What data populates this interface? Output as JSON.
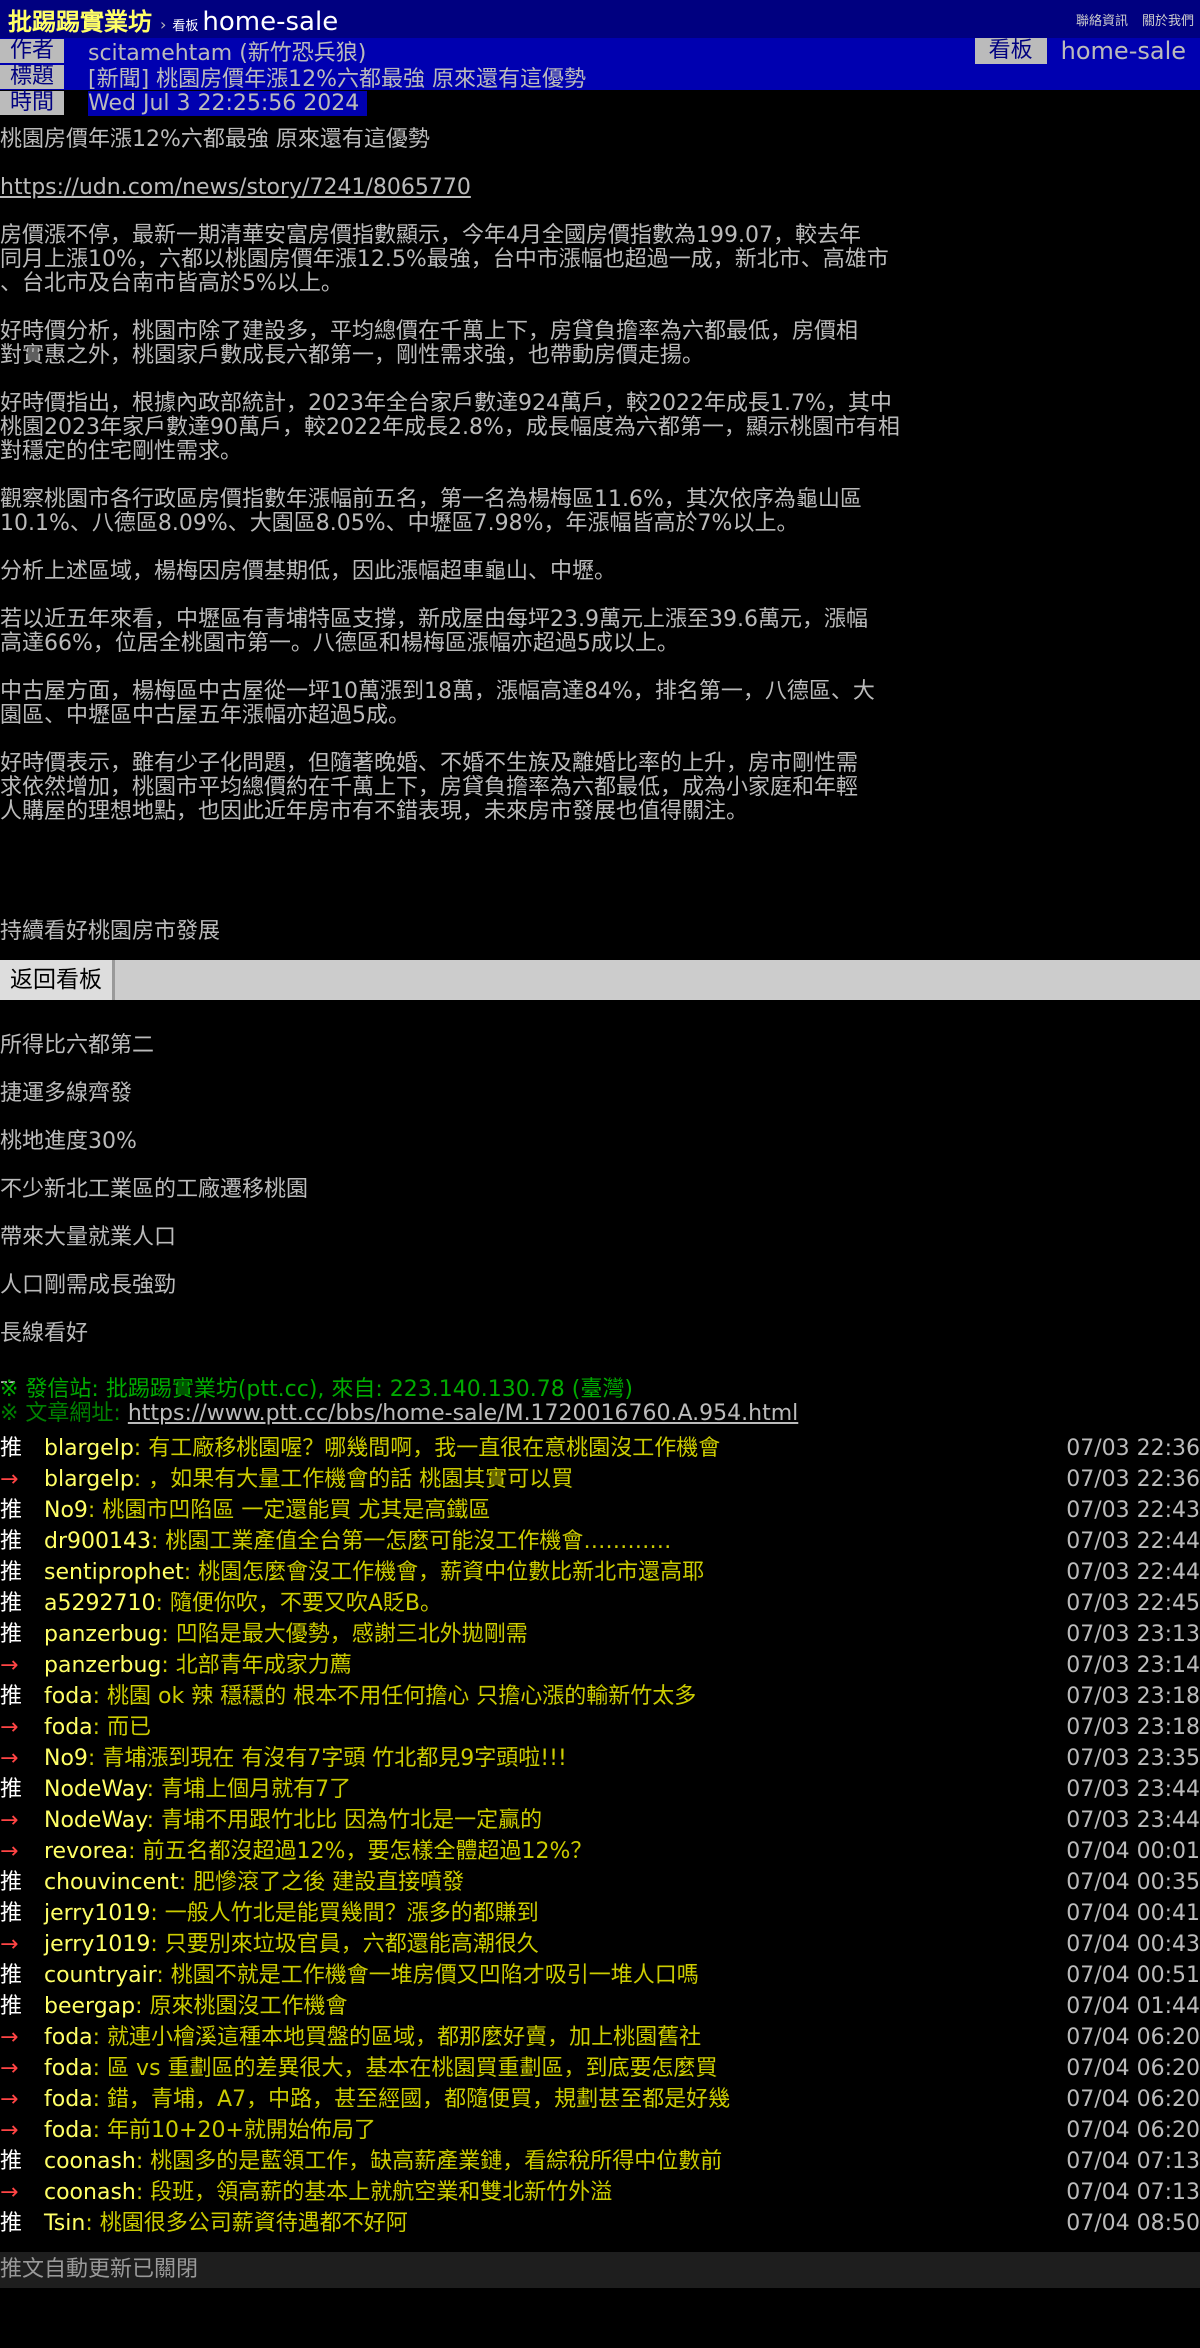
{
  "header": {
    "site": "批踢踢實業坊",
    "sep": "›",
    "board_tag": "看板",
    "board": "home-sale",
    "links": [
      "聯絡資訊",
      "關於我們"
    ]
  },
  "meta": {
    "author_tag": "作者",
    "author": "scitamehtam (新竹恐兵狼)",
    "title_tag": "標題",
    "title": "[新聞] 桃園房價年漲12%六都最強 原來還有這優勢",
    "time_tag": "時間",
    "time": "Wed Jul  3 22:25:56 2024",
    "board_tag": "看板",
    "board": "home-sale"
  },
  "article": {
    "headline": "桃園房價年漲12%六都最強 原來還有這優勢",
    "url": "https://udn.com/news/story/7241/8065770",
    "paragraphs": [
      "房價漲不停，最新一期清華安富房價指數顯示，今年4月全國房價指數為199.07，較去年\n同月上漲10%，六都以桃園房價年漲12.5%最強，台中市漲幅也超過一成，新北市、高雄市\n、台北市及台南市皆高於5%以上。",
      "好時價分析，桃園市除了建設多，平均總價在千萬上下，房貸負擔率為六都最低，房價相\n對實惠之外，桃園家戶數成長六都第一，剛性需求強，也帶動房價走揚。",
      "好時價指出，根據內政部統計，2023年全台家戶數達924萬戶，較2022年成長1.7%，其中\n桃園2023年家戶數達90萬戶，較2022年成長2.8%，成長幅度為六都第一，顯示桃園市有相\n對穩定的住宅剛性需求。",
      "觀察桃園市各行政區房價指數年漲幅前五名，第一名為楊梅區11.6%，其次依序為龜山區\n10.1%、八德區8.09%、大園區8.05%、中壢區7.98%，年漲幅皆高於7%以上。",
      "分析上述區域，楊梅因房價基期低，因此漲幅超車龜山、中壢。",
      "若以近五年來看，中壢區有青埔特區支撐，新成屋由每坪23.9萬元上漲至39.6萬元，漲幅\n高達66%，位居全桃園市第一。八德區和楊梅區漲幅亦超過5成以上。",
      "中古屋方面，楊梅區中古屋從一坪10萬漲到18萬，漲幅高達84%，排名第一，八德區、大\n園區、中壢區中古屋五年漲幅亦超過5成。",
      "好時價表示，雖有少子化問題，但隨著晚婚、不婚不生族及離婚比率的上升，房市剛性需\n求依然增加，桃園市平均總價約在千萬上下，房貸負擔率為六都最低，成為小家庭和年輕\n人購屋的理想地點，也因此近年房市有不錯表現，未來房市發展也值得關注。"
    ],
    "closing": "持續看好桃園房市發展"
  },
  "back_button": "返回看板",
  "signature_lines": [
    "所得比六都第二",
    "捷運多線齊發",
    "桃地進度30%",
    "不少新北工業區的工廠遷移桃園",
    "帶來大量就業人口",
    "人口剛需成長強勁",
    "長線看好"
  ],
  "footer": {
    "divider": "--",
    "source_prefix": "※ 發信站: ",
    "source_text": "批踢踢實業坊(ptt.cc), 來自: 223.140.130.78 (臺灣)",
    "url_prefix": "※ 文章網址: ",
    "url": "https://www.ptt.cc/bbs/home-sale/M.1720016760.A.954.html"
  },
  "pushes": [
    {
      "tag": "推",
      "user": "blargelp",
      "content": ": 有工廠移桃園喔？哪幾間啊，我一直很在意桃園沒工作機會",
      "time": "07/03 22:36"
    },
    {
      "tag": "→",
      "user": "blargelp",
      "content": ": ，如果有大量工作機會的話 桃園其實可以買",
      "time": "07/03 22:36"
    },
    {
      "tag": "推",
      "user": "No9",
      "content": ": 桃園市凹陷區 一定還能買 尤其是高鐵區",
      "time": "07/03 22:43"
    },
    {
      "tag": "推",
      "user": "dr900143",
      "content": ": 桃園工業產值全台第一怎麼可能沒工作機會…………",
      "time": "07/03 22:44"
    },
    {
      "tag": "推",
      "user": "sentiprophet",
      "content": ": 桃園怎麼會沒工作機會，薪資中位數比新北市還高耶",
      "time": "07/03 22:44"
    },
    {
      "tag": "推",
      "user": "a5292710",
      "content": ": 隨便你吹，不要又吹A貶B。",
      "time": "07/03 22:45"
    },
    {
      "tag": "推",
      "user": "panzerbug",
      "content": ": 凹陷是最大優勢，感謝三北外拋剛需",
      "time": "07/03 23:13"
    },
    {
      "tag": "→",
      "user": "panzerbug",
      "content": ": 北部青年成家力薦",
      "time": "07/03 23:14"
    },
    {
      "tag": "推",
      "user": "foda",
      "content": ": 桃園 ok 辣 穩穩的 根本不用任何擔心 只擔心漲的輸新竹太多",
      "time": "07/03 23:18"
    },
    {
      "tag": "→",
      "user": "foda",
      "content": ": 而已",
      "time": "07/03 23:18"
    },
    {
      "tag": "→",
      "user": "No9",
      "content": ": 青埔漲到現在 有沒有7字頭 竹北都見9字頭啦!!!",
      "time": "07/03 23:35"
    },
    {
      "tag": "推",
      "user": "NodeWay",
      "content": ": 青埔上個月就有7了",
      "time": "07/03 23:44"
    },
    {
      "tag": "→",
      "user": "NodeWay",
      "content": ": 青埔不用跟竹北比 因為竹北是一定贏的",
      "time": "07/03 23:44"
    },
    {
      "tag": "→",
      "user": "revorea",
      "content": ": 前五名都沒超過12%，要怎樣全體超過12%？",
      "time": "07/04 00:01"
    },
    {
      "tag": "推",
      "user": "chouvincent",
      "content": ": 肥慘滾了之後 建設直接噴發",
      "time": "07/04 00:35"
    },
    {
      "tag": "推",
      "user": "jerry1019",
      "content": ": 一般人竹北是能買幾間？漲多的都賺到",
      "time": "07/04 00:41"
    },
    {
      "tag": "→",
      "user": "jerry1019",
      "content": ": 只要別來垃圾官員，六都還能高潮很久",
      "time": "07/04 00:43"
    },
    {
      "tag": "推",
      "user": "countryair",
      "content": ": 桃園不就是工作機會一堆房價又凹陷才吸引一堆人口嗎",
      "time": "07/04 00:51"
    },
    {
      "tag": "推",
      "user": "beergap",
      "content": ": 原來桃園沒工作機會",
      "time": "07/04 01:44"
    },
    {
      "tag": "→",
      "user": "foda",
      "content": ": 就連小檜溪這種本地買盤的區域，都那麼好賣，加上桃園舊社",
      "time": "07/04 06:20"
    },
    {
      "tag": "→",
      "user": "foda",
      "content": ": 區 vs 重劃區的差異很大，基本在桃園買重劃區，到底要怎麼買",
      "time": "07/04 06:20"
    },
    {
      "tag": "→",
      "user": "foda",
      "content": ": 錯，青埔，A7，中路，甚至經國，都隨便買，規劃甚至都是好幾",
      "time": "07/04 06:20"
    },
    {
      "tag": "→",
      "user": "foda",
      "content": ": 年前10+20+就開始佈局了",
      "time": "07/04 06:20"
    },
    {
      "tag": "推",
      "user": "coonash",
      "content": ": 桃園多的是藍領工作，缺高薪產業鏈，看綜稅所得中位數前",
      "time": "07/04 07:13"
    },
    {
      "tag": "→",
      "user": "coonash",
      "content": ": 段班，領高薪的基本上就航空業和雙北新竹外溢",
      "time": "07/04 07:13"
    },
    {
      "tag": "推",
      "user": "Tsin",
      "content": ": 桃園很多公司薪資待遇都不好阿",
      "time": "07/04 08:50"
    }
  ],
  "auto_update": "推文自動更新已關閉"
}
